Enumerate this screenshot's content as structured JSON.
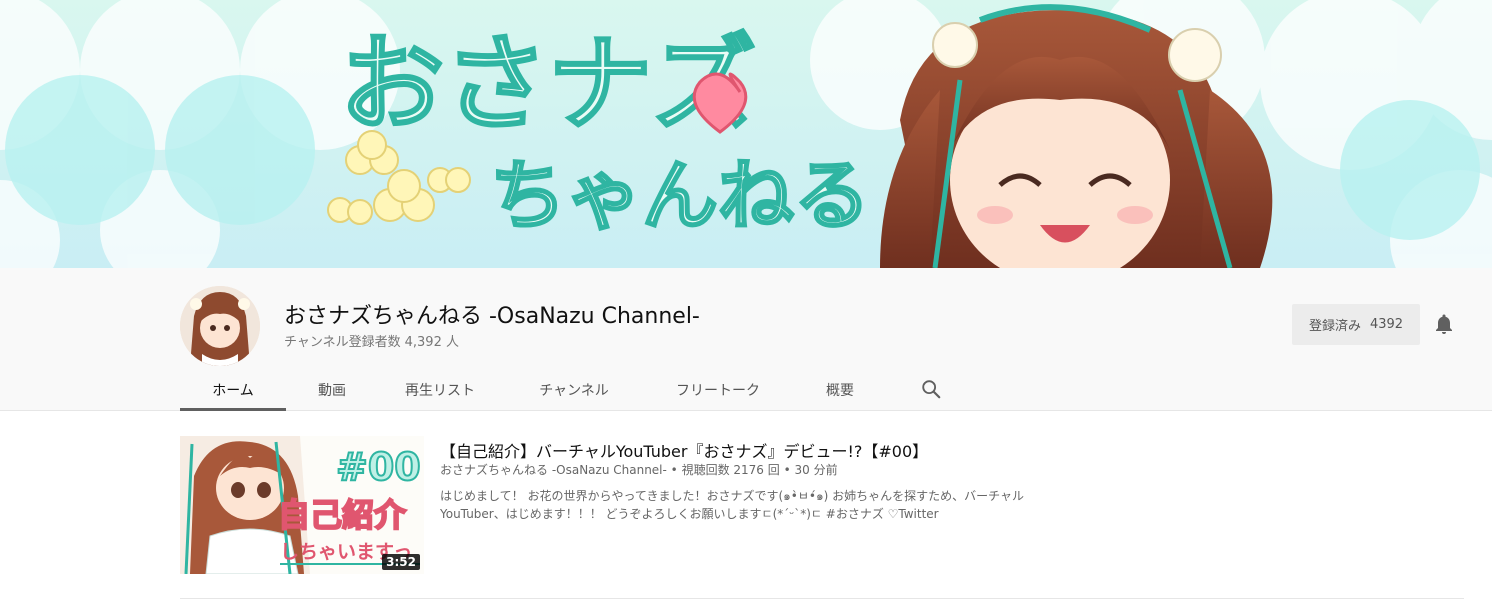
{
  "banner": {
    "logo_line1": "おさナズ",
    "logo_line2": "ちゃんねる"
  },
  "channel": {
    "name": "おさナズちゃんねる -OsaNazu Channel-",
    "subscriber_label": "チャンネル登録者数",
    "subscriber_count": "4,392 人"
  },
  "subscribe": {
    "label": "登録済み",
    "count": "4392"
  },
  "tabs": [
    {
      "label": "ホーム",
      "active": true
    },
    {
      "label": "動画",
      "active": false
    },
    {
      "label": "再生リスト",
      "active": false
    },
    {
      "label": "チャンネル",
      "active": false
    },
    {
      "label": "フリートーク",
      "active": false
    },
    {
      "label": "概要",
      "active": false
    }
  ],
  "icons": {
    "search": "search-icon",
    "bell": "bell-icon"
  },
  "video": {
    "title": "【自己紹介】バーチャルYouTuber『おさナズ』デビュー!?【#00】",
    "channel": "おさナズちゃんねる -OsaNazu Channel-",
    "views": "視聴回数 2176 回",
    "age": "30 分前",
    "separator": "•",
    "description": "はじめまして！ お花の世界からやってきました！おさナズです(๑•̀ㅂ•́๑) お姉ちゃんを探すため、バーチャルYouTuber、はじめます！！！ どうぞよろしくお願いしますㄷ(*´ᵕ`*)ㄷ #おさナズ ♡Twitter",
    "duration": "3:52",
    "thumb_text_big": "#00",
    "thumb_text_mid": "自己紹介",
    "thumb_text_small": "しちゃいますっ"
  },
  "colors": {
    "accent_teal": "#2fb5a2",
    "banner_bg": "#cfeff0"
  }
}
